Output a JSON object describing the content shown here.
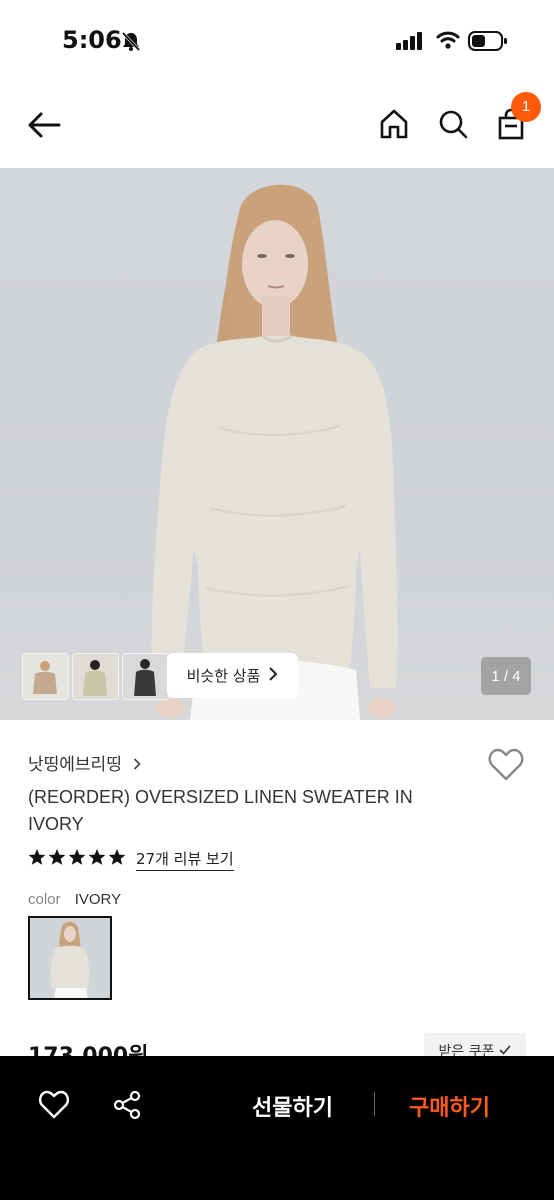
{
  "status_bar": {
    "time": "5:06"
  },
  "header": {
    "cart_count": "1"
  },
  "gallery": {
    "similar_label": "비슷한 상품",
    "counter": "1 / 4",
    "thumbnails": [
      "thumb-1",
      "thumb-2",
      "thumb-3"
    ]
  },
  "product": {
    "brand": "낫띵에브리띵",
    "title": "(REORDER) OVERSIZED LINEN SWEATER IN IVORY",
    "rating_stars": 5,
    "reviews_label": "27개 리뷰 보기",
    "color_label": "color",
    "color_value": "IVORY",
    "price": "173,000원",
    "coupon_label": "받은 쿠폰"
  },
  "bottom_bar": {
    "gift_label": "선물하기",
    "buy_label": "구매하기",
    "colors": {
      "background": "#000000",
      "buy": "#ff5a1f",
      "badge": "#ff5a0a"
    }
  }
}
